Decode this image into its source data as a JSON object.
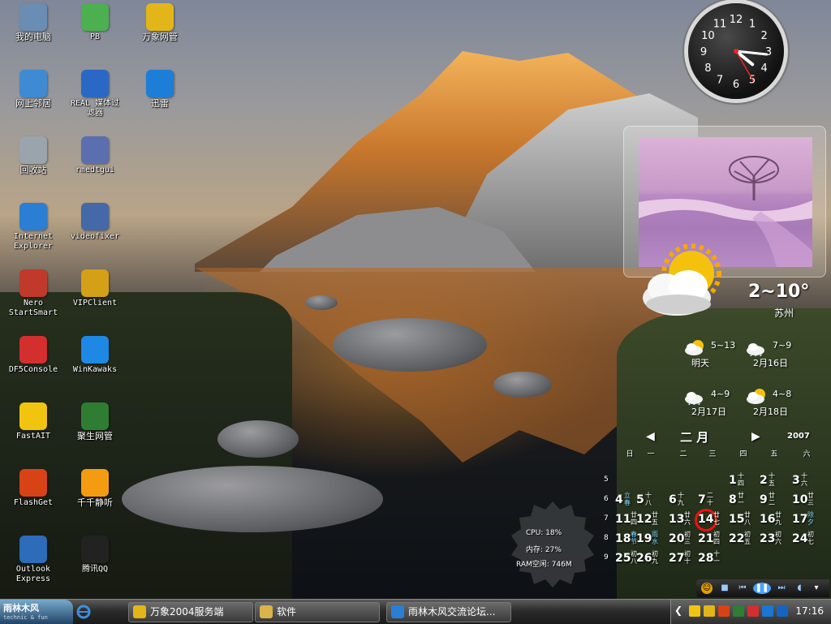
{
  "desktop_icons": [
    {
      "id": "my-computer",
      "label": "我的电脑",
      "icon": "computer-icon",
      "color": "#6a8db4"
    },
    {
      "id": "pb",
      "label": "PB",
      "icon": "pb-icon",
      "color": "#4caf50"
    },
    {
      "id": "wanxiang",
      "label": "万象网管",
      "icon": "wanxiang-icon",
      "color": "#e2b619"
    },
    {
      "id": "network",
      "label": "网上邻居",
      "icon": "network-places-icon",
      "color": "#3f8bd3"
    },
    {
      "id": "real-filter",
      "label": "REAL 媒体过\n滤器",
      "icon": "real-filter-icon",
      "color": "#2b68c6"
    },
    {
      "id": "xunlei",
      "label": "迅雷",
      "icon": "thunder-icon",
      "color": "#1d7ed8"
    },
    {
      "id": "recycle",
      "label": "回收站",
      "icon": "recycle-bin-icon",
      "color": "#9aa4ad"
    },
    {
      "id": "rmedtgui",
      "label": "rmedtgui",
      "icon": "rmedtgui-icon",
      "color": "#5b6fb0"
    },
    {
      "id": "ie",
      "label": "Internet\nExplorer",
      "icon": "internet-explorer-icon",
      "color": "#2a7fd4"
    },
    {
      "id": "videofixer",
      "label": "videofixer",
      "icon": "videofixer-icon",
      "color": "#4468a8"
    },
    {
      "id": "nero",
      "label": "Nero\nStartSmart",
      "icon": "nero-icon",
      "color": "#c0392b"
    },
    {
      "id": "vipclient",
      "label": "VIPClient",
      "icon": "vipclient-icon",
      "color": "#d4a017"
    },
    {
      "id": "df5",
      "label": "DF5Console",
      "icon": "df5console-icon",
      "color": "#d32f2f"
    },
    {
      "id": "winkawaks",
      "label": "WinKawaks",
      "icon": "winkawaks-icon",
      "color": "#1e88e5"
    },
    {
      "id": "fastait",
      "label": "FastAIT",
      "icon": "fastait-icon",
      "color": "#f1c40f"
    },
    {
      "id": "jusheng",
      "label": "聚生网管",
      "icon": "jusheng-icon",
      "color": "#2e7d32"
    },
    {
      "id": "flashget",
      "label": "FlashGet",
      "icon": "flashget-icon",
      "color": "#d84315"
    },
    {
      "id": "ttplayer",
      "label": "千千静听",
      "icon": "ttplayer-icon",
      "color": "#f39c12"
    },
    {
      "id": "outlook",
      "label": "Outlook\nExpress",
      "icon": "outlook-express-icon",
      "color": "#2c6cb8"
    },
    {
      "id": "qq",
      "label": "腾讯QQ",
      "icon": "qq-penguin-icon",
      "color": "#222222"
    }
  ],
  "clock": {
    "numerals": [
      "12",
      "1",
      "2",
      "3",
      "4",
      "5",
      "6",
      "7",
      "8",
      "9",
      "10",
      "11"
    ],
    "hour": 4.3,
    "minute": 16,
    "second": 25
  },
  "weather": {
    "temp": "2~10°",
    "city": "苏州",
    "icon": "sun-cloud-icon",
    "forecast": [
      {
        "temp": "5~13",
        "day": "明天",
        "icon": "sun-cloud-icon"
      },
      {
        "temp": "7~9",
        "day": "2月16日",
        "icon": "rain-cloud-icon"
      },
      {
        "temp": "4~9",
        "day": "2月17日",
        "icon": "rain-cloud-icon"
      },
      {
        "temp": "4~8",
        "day": "2月18日",
        "icon": "sun-cloud-icon"
      }
    ]
  },
  "calendar": {
    "month": "二 月",
    "year": "2007",
    "weekdays": [
      "日",
      "一",
      "二",
      "三",
      "四",
      "五",
      "六"
    ],
    "weeks": [
      "5",
      "6",
      "7",
      "8",
      "9"
    ],
    "days": [
      {
        "n": "1",
        "l": "十\n四"
      },
      {
        "n": "2",
        "l": "十\n五"
      },
      {
        "n": "3",
        "l": "十\n六"
      },
      {
        "n": "4",
        "l": "立\n春",
        "hol": true
      },
      {
        "n": "5",
        "l": "十\n八"
      },
      {
        "n": "6",
        "l": "十\n九"
      },
      {
        "n": "7",
        "l": "二\n十"
      },
      {
        "n": "8",
        "l": "廿\n一"
      },
      {
        "n": "9",
        "l": "廿\n二"
      },
      {
        "n": "10",
        "l": "廿\n三"
      },
      {
        "n": "11",
        "l": "廿\n四"
      },
      {
        "n": "12",
        "l": "廿\n五"
      },
      {
        "n": "13",
        "l": "廿\n六"
      },
      {
        "n": "14",
        "l": "廿\n七"
      },
      {
        "n": "15",
        "l": "廿\n八"
      },
      {
        "n": "16",
        "l": "廿\n九"
      },
      {
        "n": "17",
        "l": "除\n夕",
        "hol": true
      },
      {
        "n": "18",
        "l": "春\n节",
        "hol": true
      },
      {
        "n": "19",
        "l": "雨\n水",
        "hol": true
      },
      {
        "n": "20",
        "l": "初\n三"
      },
      {
        "n": "21",
        "l": "初\n四"
      },
      {
        "n": "22",
        "l": "初\n五"
      },
      {
        "n": "23",
        "l": "初\n六"
      },
      {
        "n": "24",
        "l": "初\n七"
      },
      {
        "n": "25",
        "l": "初\n八"
      },
      {
        "n": "26",
        "l": "初\n九"
      },
      {
        "n": "27",
        "l": "初\n十"
      },
      {
        "n": "28",
        "l": "十\n一"
      }
    ],
    "today": "14"
  },
  "meter": {
    "cpu": "CPU: 18%",
    "mem": "内存: 27%",
    "ram": "RAM空闲: 746M"
  },
  "taskbar": {
    "start_logo": "雨林木风",
    "start_sub": "technic & fun",
    "tasks": [
      {
        "label": "万象2004服务端",
        "icon": "wanxiang-icon",
        "color": "#e2b619"
      },
      {
        "label": "软件",
        "icon": "folder-icon",
        "color": "#d9b44a"
      },
      {
        "label": "雨林木风交流论坛...",
        "icon": "internet-explorer-icon",
        "color": "#2a7fd4"
      }
    ],
    "time": "17:16"
  }
}
